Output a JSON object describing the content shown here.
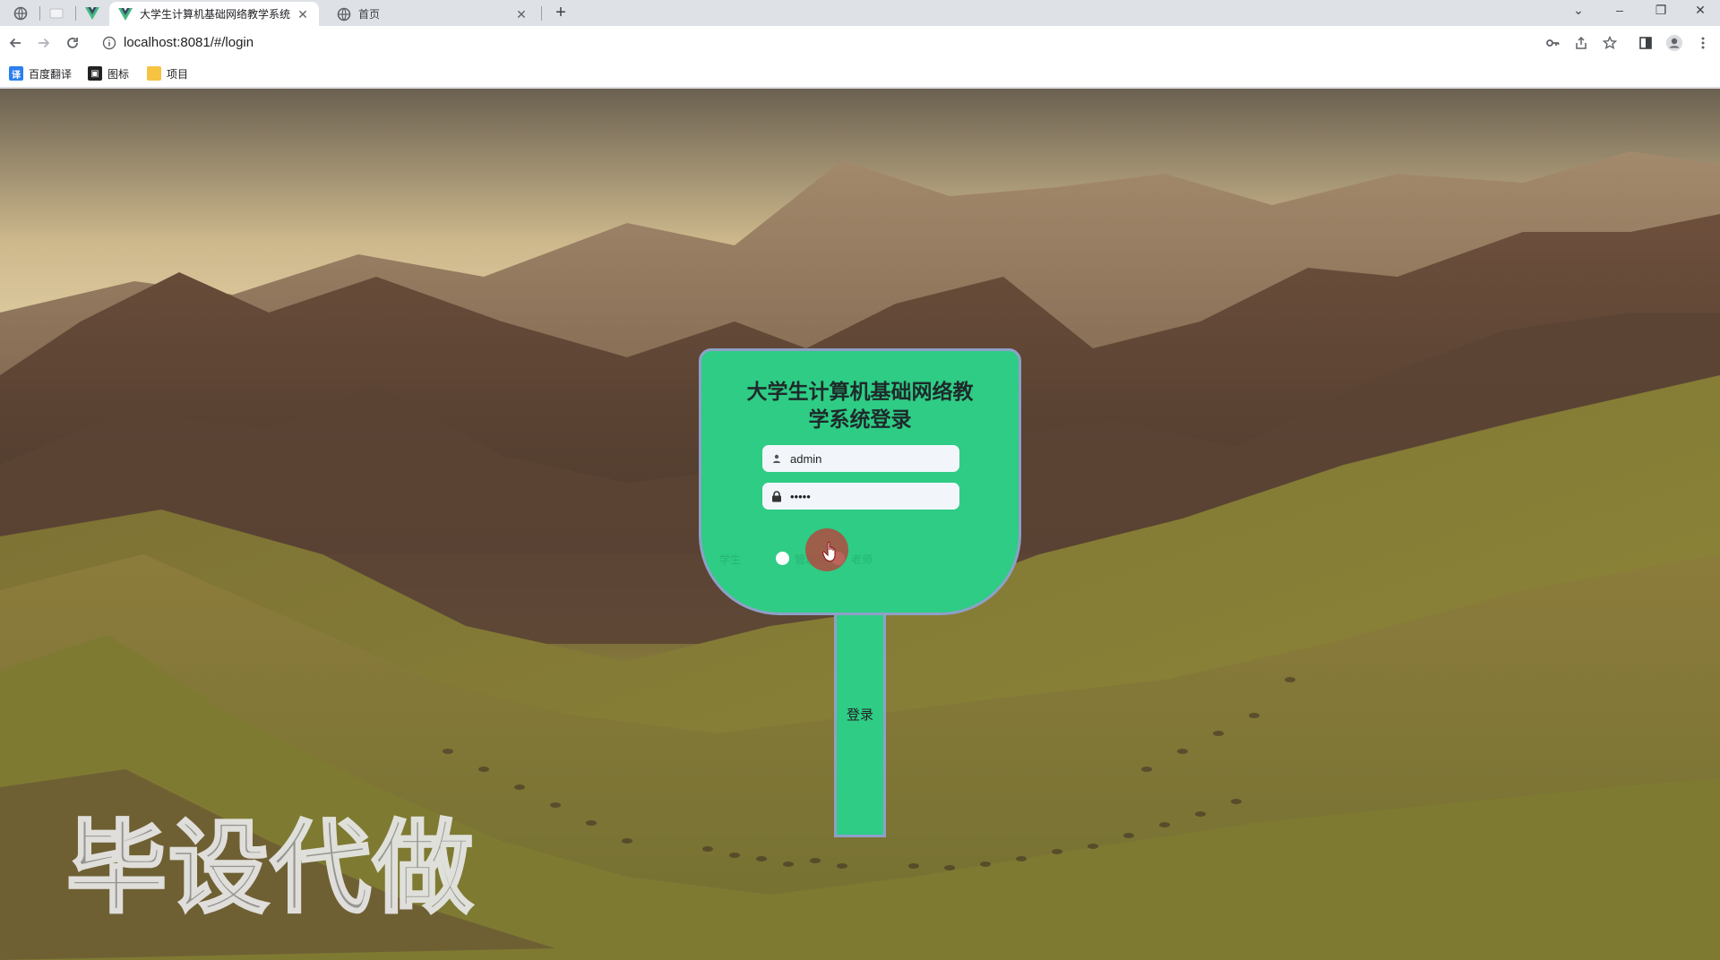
{
  "browser": {
    "tabs": [
      {
        "title": "大学生计算机基础网络教学系统",
        "active": true,
        "icon": "vue-logo-icon"
      },
      {
        "title": "首页",
        "active": false,
        "icon": "globe-icon"
      }
    ],
    "new_tab": "+",
    "window_controls": {
      "tab_search": "⌄",
      "minimize": "–",
      "restore": "❐",
      "close": "✕"
    },
    "url": "localhost:8081/#/login",
    "bookmarks": [
      {
        "label": "百度翻译",
        "icon": "translate-icon",
        "color": "#2b7ff0"
      },
      {
        "label": "图标",
        "icon": "iconfont-icon",
        "color": "#222222"
      },
      {
        "label": "项目",
        "icon": "folder-icon",
        "color": "#f6c343"
      }
    ]
  },
  "login": {
    "title": "大学生计算机基础网络教学系统登录",
    "username_value": "admin",
    "password_value": "•••••",
    "roles": [
      "学生",
      "管理员",
      "老师"
    ],
    "submit_label": "登录",
    "sign_color": "#2ecc85",
    "border_color": "#8fa0c8"
  },
  "watermark": "毕设代做"
}
